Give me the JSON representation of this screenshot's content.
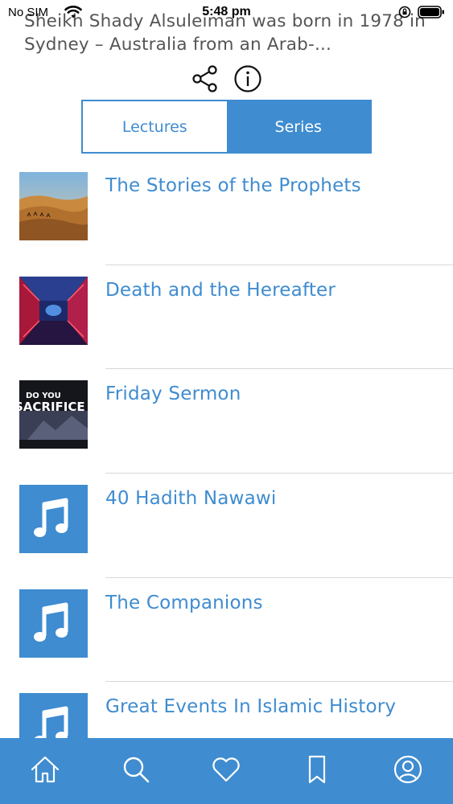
{
  "status_bar": {
    "carrier": "No SIM",
    "time": "5:48 pm"
  },
  "description": "Sheikh Shady Alsuleiman was born in 1978 in Sydney – Australia from an Arab-...",
  "segments": {
    "lectures_label": "Lectures",
    "series_label": "Series",
    "selected": "Series"
  },
  "series": [
    {
      "title": "The Stories of the Prophets",
      "thumb": "desert-image"
    },
    {
      "title": "Death and the Hereafter",
      "thumb": "tunnel-image"
    },
    {
      "title": "Friday Sermon",
      "thumb": "sacrifice-image",
      "thumb_text": "DO YOU SACRIFICE"
    },
    {
      "title": "40 Hadith Nawawi",
      "thumb": "music-note-icon"
    },
    {
      "title": "The Companions",
      "thumb": "music-note-icon"
    },
    {
      "title": "Great Events In Islamic History",
      "thumb": "music-note-icon"
    }
  ],
  "tab_bar": {
    "tabs": [
      "home-icon",
      "search-icon",
      "heart-icon",
      "bookmark-icon",
      "profile-icon"
    ]
  },
  "colors": {
    "accent": "#3f8cd0",
    "divider": "#d8d8d8"
  }
}
